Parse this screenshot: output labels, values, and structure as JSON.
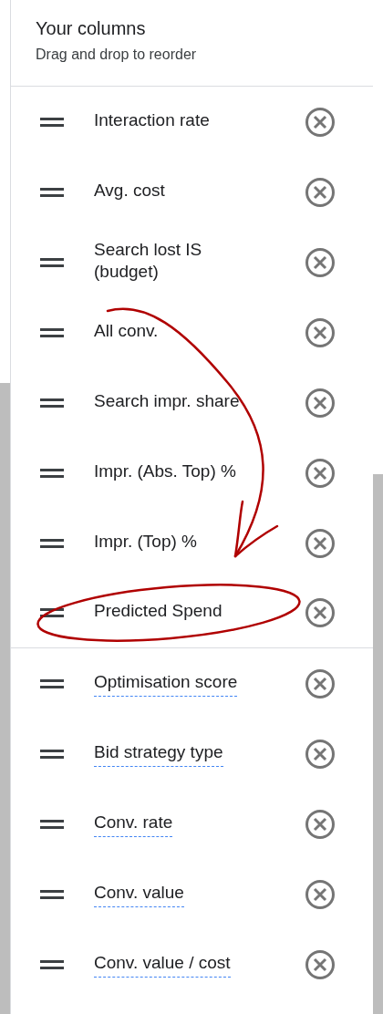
{
  "header": {
    "title": "Your columns",
    "subtitle": "Drag and drop to reorder"
  },
  "columns": [
    {
      "label": "Interaction rate",
      "underlined": false,
      "divider_after": false
    },
    {
      "label": "Avg. cost",
      "underlined": false,
      "divider_after": false
    },
    {
      "label": "Search lost IS (budget)",
      "underlined": false,
      "divider_after": false
    },
    {
      "label": "All conv.",
      "underlined": false,
      "divider_after": false
    },
    {
      "label": "Search impr. share",
      "underlined": false,
      "divider_after": false
    },
    {
      "label": "Impr. (Abs. Top) %",
      "underlined": false,
      "divider_after": false
    },
    {
      "label": "Impr. (Top) %",
      "underlined": false,
      "divider_after": false
    },
    {
      "label": "Predicted Spend",
      "underlined": false,
      "divider_after": true
    },
    {
      "label": "Optimisation score",
      "underlined": true,
      "divider_after": false
    },
    {
      "label": "Bid strategy type",
      "underlined": true,
      "divider_after": false
    },
    {
      "label": "Conv. rate",
      "underlined": true,
      "divider_after": false
    },
    {
      "label": "Conv. value",
      "underlined": true,
      "divider_after": false
    },
    {
      "label": "Conv. value / cost",
      "underlined": true,
      "divider_after": false
    }
  ]
}
